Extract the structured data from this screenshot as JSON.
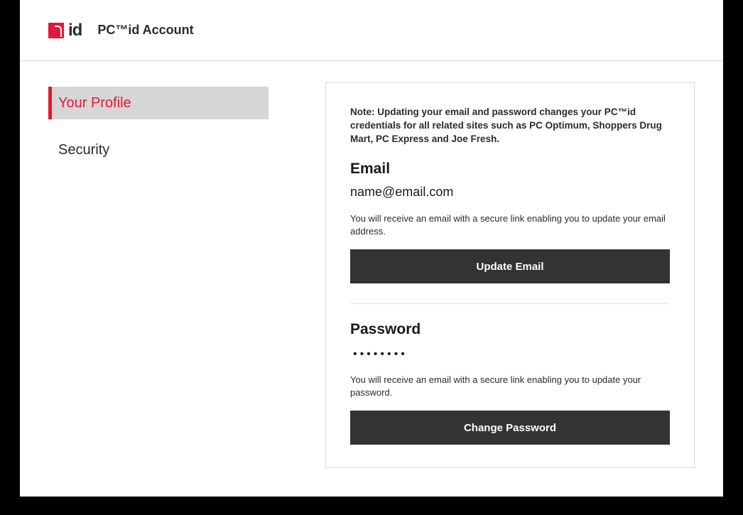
{
  "logo_text": "id",
  "app_title": "PC™id Account",
  "sidebar": {
    "items": [
      {
        "label": "Your Profile",
        "active": true
      },
      {
        "label": "Security",
        "active": false
      }
    ]
  },
  "panel": {
    "note": "Note: Updating your email and password changes your PC™id credentials for all related sites such as PC Optimum, Shoppers Drug Mart, PC Express and Joe Fresh.",
    "email": {
      "title": "Email",
      "value": "name@email.com",
      "helper": "You will receive an email with a secure link enabling you to update your email address.",
      "button": "Update Email"
    },
    "password": {
      "title": "Password",
      "masked": "••••••••",
      "helper": "You will receive an email with a secure link enabling you to update your password.",
      "button": "Change Password"
    }
  }
}
